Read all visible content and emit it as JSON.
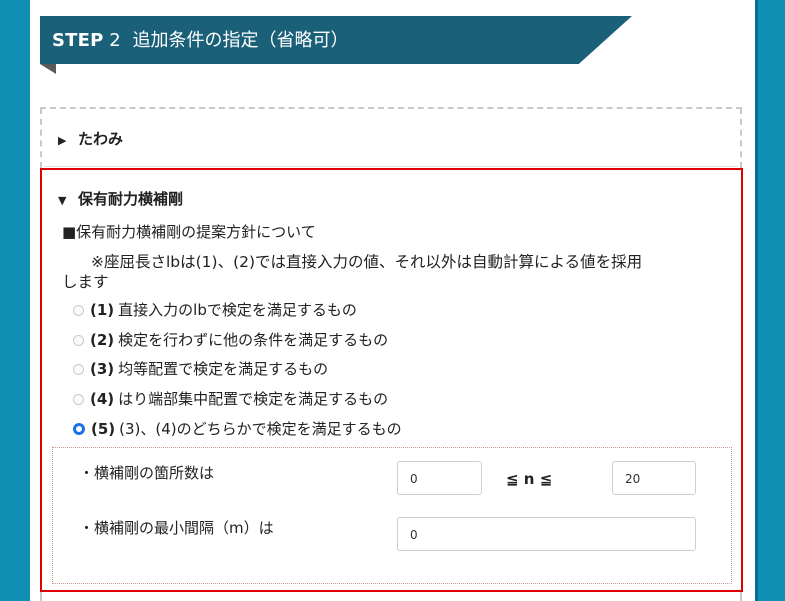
{
  "step": {
    "label": "STEP",
    "number": "2",
    "title": "追加条件の指定（省略可）"
  },
  "sections": {
    "deflection": {
      "label": "たわみ",
      "expanded": false,
      "marker": "▶"
    },
    "bracing": {
      "label": "保有耐力横補剛",
      "expanded": true,
      "marker": "▼"
    }
  },
  "bracing": {
    "heading": "■保有耐力横補剛の提案方針について",
    "note_line1": "※座屈長さlbは(1)、(2)では直接入力の値、それ以外は自動計算による値を採用",
    "note_line2": "します",
    "options": [
      {
        "num": "(1)",
        "label": "直接入力のlbで検定を満足するもの",
        "checked": false
      },
      {
        "num": "(2)",
        "label": "検定を行わずに他の条件を満足するもの",
        "checked": false
      },
      {
        "num": "(3)",
        "label": "均等配置で検定を満足するもの",
        "checked": false
      },
      {
        "num": "(4)",
        "label": "はり端部集中配置で検定を満足するもの",
        "checked": false
      },
      {
        "num": "(5)",
        "label": "(3)、(4)のどちらかで検定を満足するもの",
        "checked": true
      }
    ],
    "count_label": "・横補剛の箇所数は",
    "count_min": "0",
    "count_op": "≦ n ≦",
    "count_max": "20",
    "spacing_label": "・横補剛の最小間隔（m）は",
    "spacing_value": "0"
  },
  "colors": {
    "frame": "#0e8fb3",
    "banner": "#1a6079",
    "highlight": "#e00000",
    "radio_checked": "#1a73e8"
  }
}
